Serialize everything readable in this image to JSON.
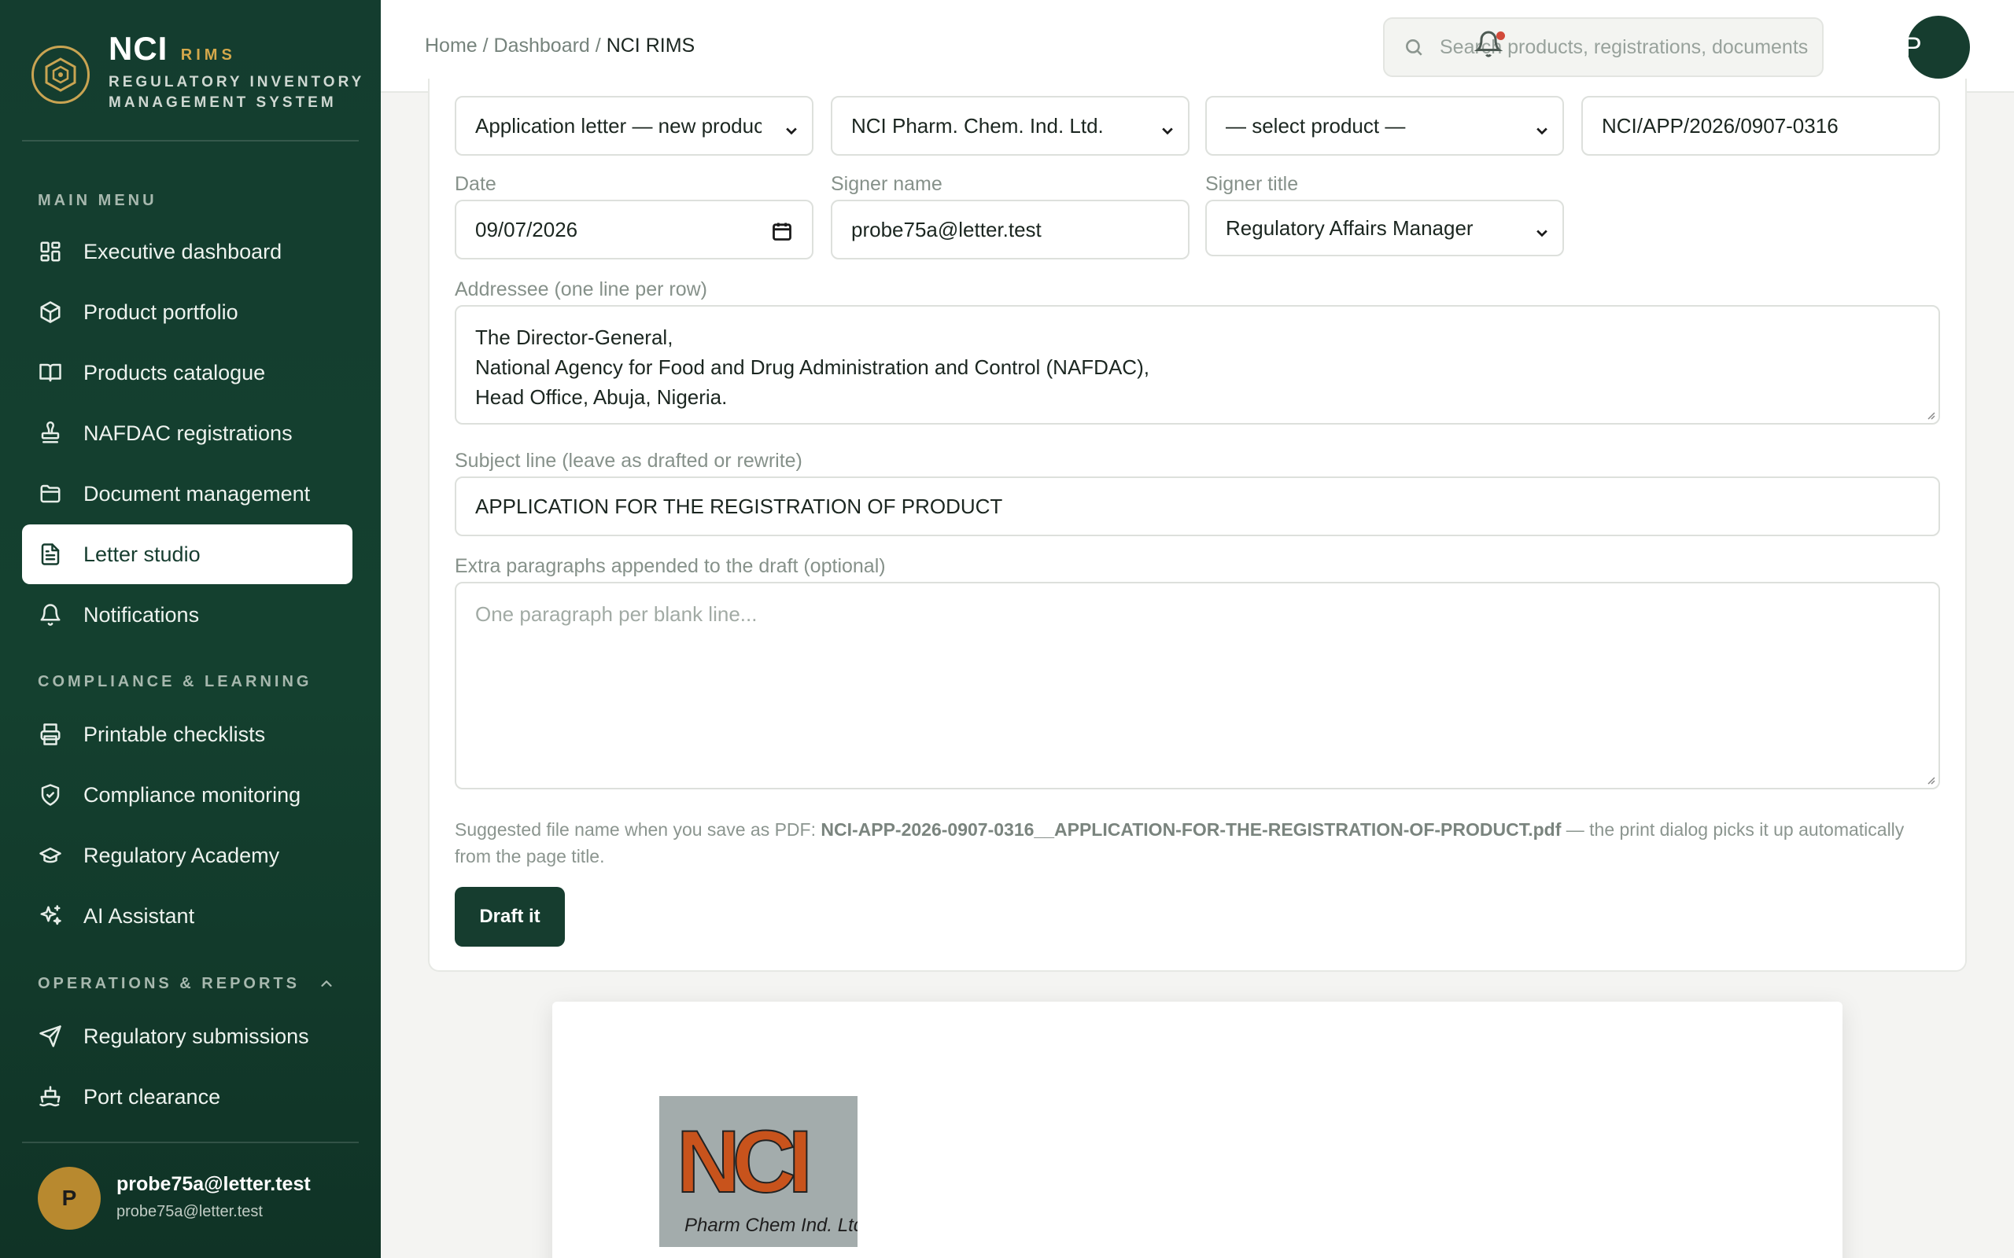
{
  "brand": {
    "name": "NCI",
    "tag": "RIMS",
    "subtitle_line1": "REGULATORY INVENTORY",
    "subtitle_line2": "MANAGEMENT SYSTEM"
  },
  "sidebar": {
    "sections": [
      {
        "label": "MAIN MENU"
      },
      {
        "label": "COMPLIANCE & LEARNING"
      },
      {
        "label": "OPERATIONS & REPORTS"
      }
    ],
    "items": [
      {
        "label": "Executive dashboard",
        "icon": "dashboard-icon"
      },
      {
        "label": "Product portfolio",
        "icon": "package-icon"
      },
      {
        "label": "Products catalogue",
        "icon": "book-icon"
      },
      {
        "label": "NAFDAC registrations",
        "icon": "stamp-icon"
      },
      {
        "label": "Document management",
        "icon": "folder-icon"
      },
      {
        "label": "Letter studio",
        "icon": "document-icon",
        "active": true
      },
      {
        "label": "Notifications",
        "icon": "bell-icon"
      },
      {
        "label": "Printable checklists",
        "icon": "printer-icon"
      },
      {
        "label": "Compliance monitoring",
        "icon": "shield-icon"
      },
      {
        "label": "Regulatory Academy",
        "icon": "graduation-cap-icon"
      },
      {
        "label": "AI Assistant",
        "icon": "sparkles-icon"
      },
      {
        "label": "Regulatory submissions",
        "icon": "send-icon"
      },
      {
        "label": "Port clearance",
        "icon": "ship-icon"
      }
    ],
    "user": {
      "initial": "P",
      "name": "probe75a@letter.test",
      "email": "probe75a@letter.test"
    }
  },
  "topbar": {
    "breadcrumb": {
      "home": "Home",
      "sep1": " / ",
      "dashboard": "Dashboard",
      "sep2": " / ",
      "current": "NCI RIMS"
    },
    "search_placeholder": "Search products, registrations, documents...",
    "avatar_initial": "P"
  },
  "form": {
    "letter_type": "Application letter — new product",
    "company": "NCI Pharm. Chem. Ind. Ltd.",
    "product": "— select product —",
    "reference": "NCI/APP/2026/0907-0316",
    "date_label": "Date",
    "date_value": "09/07/2026",
    "signer_name_label": "Signer name",
    "signer_name_value": "probe75a@letter.test",
    "signer_title_label": "Signer title",
    "signer_title_value": "Regulatory Affairs Manager",
    "addressee_label": "Addressee (one line per row)",
    "addressee_lines": [
      "The Director-General,",
      "National Agency for Food and Drug Administration and Control (NAFDAC),",
      "Head Office, Abuja, Nigeria."
    ],
    "subject_label": "Subject line (leave as drafted or rewrite)",
    "subject_value": "APPLICATION FOR THE REGISTRATION OF PRODUCT",
    "extra_label": "Extra paragraphs appended to the draft (optional)",
    "extra_placeholder": "One paragraph per blank line...",
    "hint_prefix": "Suggested file name when you save as PDF: ",
    "hint_filename": "NCI-APP-2026-0907-0316__APPLICATION-FOR-THE-REGISTRATION-OF-PRODUCT.pdf",
    "hint_suffix": " — the print dialog picks it up automatically from the page title.",
    "draft_button": "Draft it"
  },
  "preview": {
    "logo_text": "NCI",
    "logo_subtext": "Pharm Chem Ind. Ltd"
  },
  "colors": {
    "sidebar_bg": "#143d2f",
    "accent_gold": "#c9a452",
    "primary": "#163d2f",
    "notification_dot": "#d24a3a"
  }
}
